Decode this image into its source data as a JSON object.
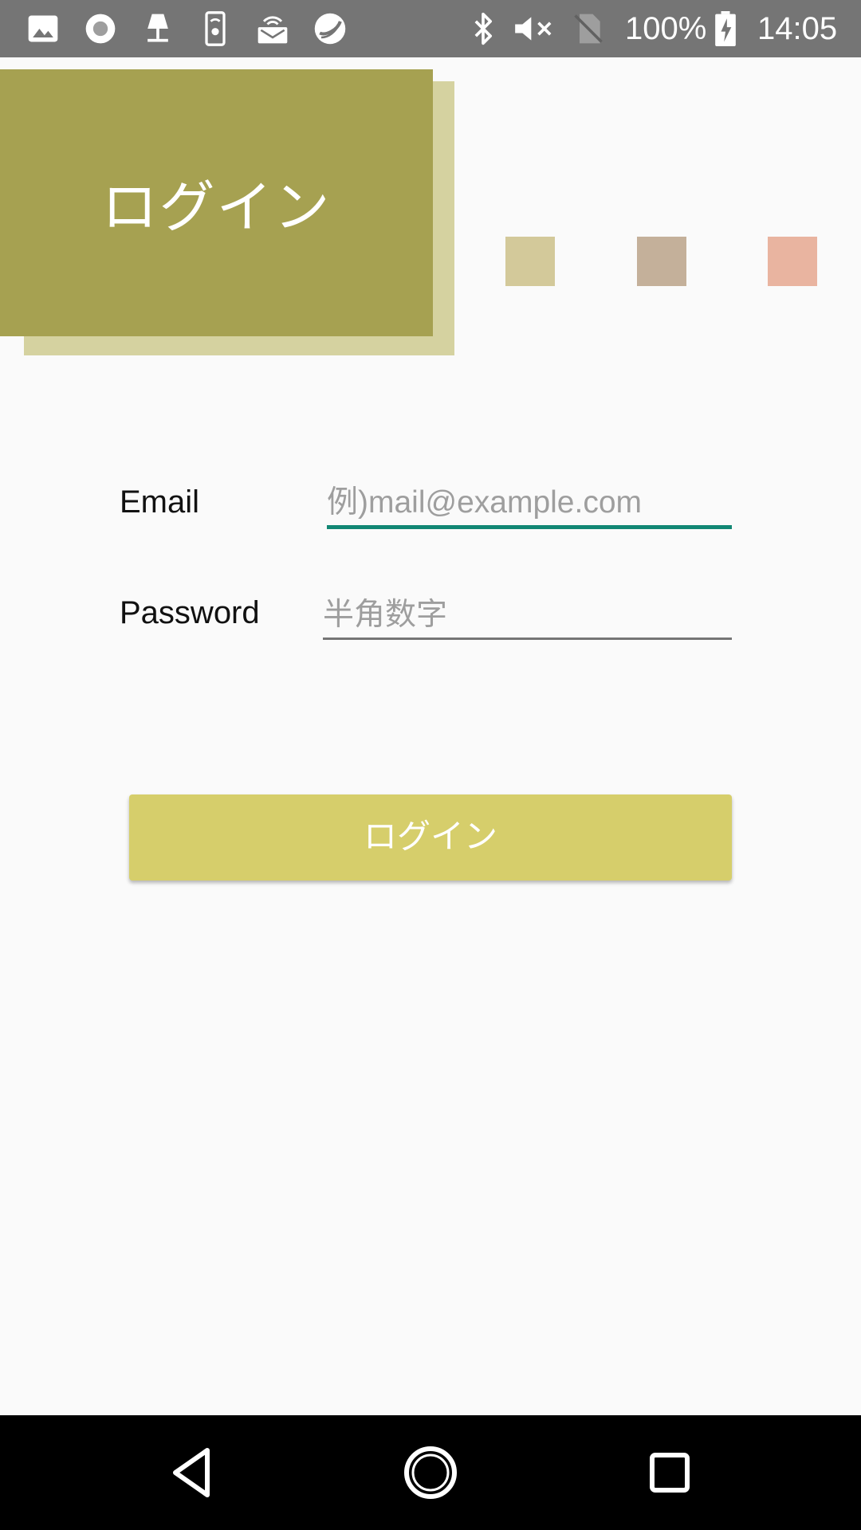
{
  "status_bar": {
    "battery": "100%",
    "time": "14:05",
    "icons": [
      "image-icon",
      "radio-icon",
      "lamp-icon",
      "phone-settings-icon",
      "wifi-router-icon",
      "swirl-icon",
      "bluetooth-icon",
      "volume-muted-icon",
      "no-sim-icon",
      "battery-charging-icon"
    ]
  },
  "header": {
    "title": "ログイン",
    "swatch_colors": [
      "#d3c99a",
      "#c4b09a",
      "#e9b4a0"
    ]
  },
  "form": {
    "email_label": "Email",
    "email_placeholder": "例)mail@example.com",
    "email_value": "",
    "password_label": "Password",
    "password_placeholder": "半角数字",
    "password_value": ""
  },
  "login_button": {
    "label": "ログイン"
  },
  "nav_bar": {
    "icons": [
      "back-icon",
      "home-icon",
      "recents-icon"
    ]
  }
}
